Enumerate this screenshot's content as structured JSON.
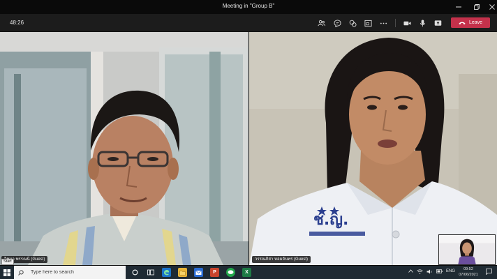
{
  "window": {
    "title": "Meeting in \"Group B\""
  },
  "toolbar": {
    "timer": "48:26",
    "leave_label": "Leave",
    "icons": [
      "people-icon",
      "chat-icon",
      "reactions-icon",
      "share-tray-icon",
      "more-options-icon",
      "camera-icon",
      "mic-icon",
      "share-screen-icon",
      "leave-phone-icon"
    ]
  },
  "participants": [
    {
      "name": "วิชนา พรรณนี (Guest)"
    },
    {
      "name": "วรรณภิสา หอมจันทร (Guest)"
    }
  ],
  "overlay": {
    "start_tooltip": "Start"
  },
  "taskbar": {
    "search_placeholder": "Type here to search",
    "language": "ENG",
    "time": "09:52",
    "date": "07/06/2021"
  },
  "colors": {
    "leave_button": "#c4314b",
    "toolbar_bg": "#1c1c1c",
    "taskbar_bg": "#1f2a33"
  }
}
